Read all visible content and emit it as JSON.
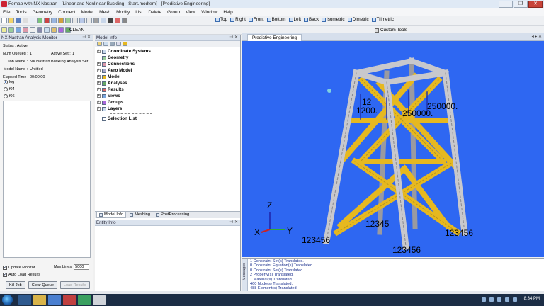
{
  "window": {
    "title": "Femap with NX Nastran - [Linear and Nonlinear Buckling - Start.modfem] - [Predictive Engineering]",
    "controls": [
      "–",
      "❐",
      "✕"
    ]
  },
  "menu": [
    "File",
    "Tools",
    "Geometry",
    "Connect",
    "Model",
    "Mesh",
    "Modify",
    "List",
    "Delete",
    "Group",
    "View",
    "Window",
    "Help"
  ],
  "toolbar": {
    "views": [
      "Top",
      "Right",
      "Front",
      "Bottom",
      "Left",
      "Back",
      "Isometric",
      "Dimetric",
      "Trimetric"
    ],
    "clean_label": "CLEAN",
    "custom_tools_label": "Custom Tools"
  },
  "analysis_monitor": {
    "title": "NX Nastran Analysis Monitor",
    "status": "Status : Active",
    "num_queued_label": "Num Queued :",
    "num_queued_value": "1",
    "active_set_label": "Active Set :",
    "active_set_value": "1",
    "job_name_label": "Job Name :",
    "job_name_value": "NX Nastran Buckling Analysis Set",
    "model_name_label": "Model Name :",
    "model_name_value": "Untitled",
    "elapsed_label": "Elapsed Time :",
    "elapsed_value": "00:00:00",
    "radio_options": [
      "log",
      "f04",
      "f06"
    ],
    "selected_radio": "log",
    "update_monitor_label": "Update Monitor",
    "auto_load_label": "Auto Load Results",
    "max_lines_label": "Max Lines",
    "max_lines_value": "5000",
    "buttons": [
      "Kill Job",
      "Clear Queue",
      "Load Results"
    ]
  },
  "model_info": {
    "title": "Model Info",
    "tree": [
      "Coordinate Systems",
      "Geometry",
      "Connections",
      "Aero Model",
      "Model",
      "Analyses",
      "Results",
      "Views",
      "Groups",
      "Layers"
    ],
    "selection_list": "Selection List",
    "tabs": [
      "Model Info",
      "Meshing",
      "PostProcessing"
    ]
  },
  "entity_info": {
    "title": "Entity Info"
  },
  "graphics": {
    "tab_title": "Predictive Engineering",
    "background_color": "#2e67f2",
    "member_color": "#e6b820",
    "leg_color": "#c8c8cc",
    "node_labels": [
      "123456",
      "123456",
      "12345",
      "123456"
    ],
    "load_labels": [
      "12",
      "1200.",
      "250000.",
      "250000."
    ],
    "triad_labels": [
      "X",
      "Y",
      "Z"
    ]
  },
  "messages": {
    "side_label": "Messages",
    "lines": [
      "1 Constraint Set(s) Translated.",
      "0 Constraint Equation(s) Translated.",
      "0 Constraint Set(s) Translated.",
      "2 Property(s) Translated.",
      "1 Material(s) Translated.",
      "460 Node(s) Translated.",
      "488 Element(s) Translated."
    ]
  },
  "taskbar": {
    "clock": "8:34 PM"
  }
}
